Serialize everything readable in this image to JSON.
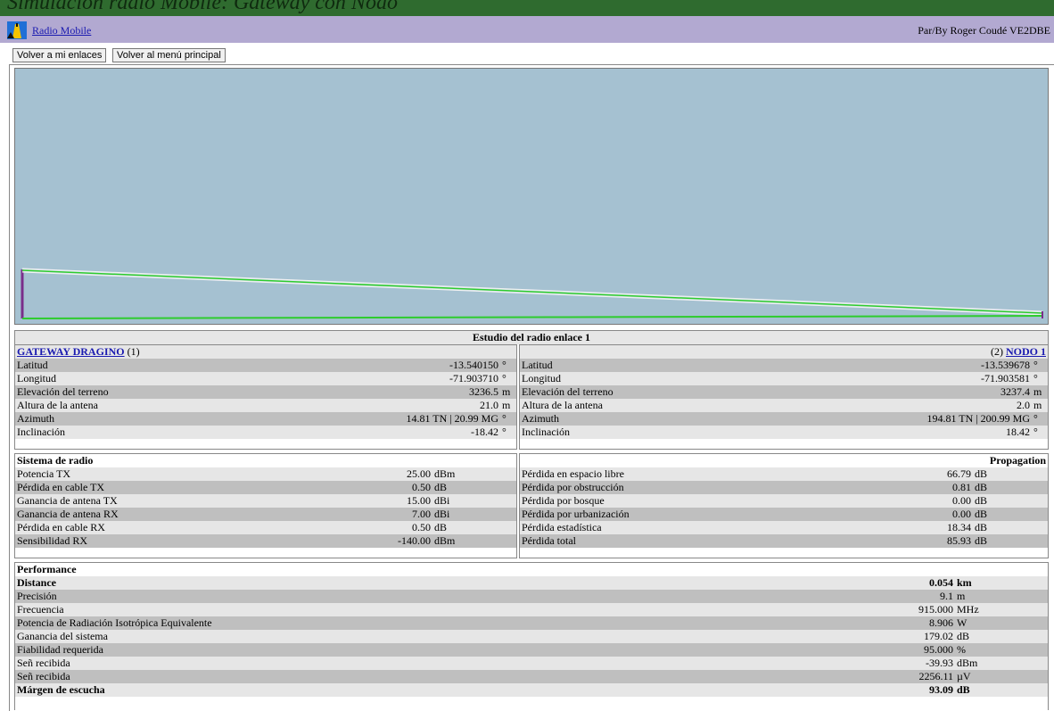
{
  "page": {
    "banner_title": "Simulación radio Mobile: Gateway con Nodo"
  },
  "header": {
    "app_link": "Radio Mobile",
    "author": "Par/By Roger Coudé VE2DBE"
  },
  "nav": {
    "back_links": "Volver a mi enlaces",
    "back_menu": "Volver al menú principal"
  },
  "study": {
    "title": "Estudio del radio enlace 1",
    "left": {
      "name": "GATEWAY DRAGINO",
      "index": "(1)",
      "rows": [
        {
          "label": "Latitud",
          "value": "-13.540150",
          "unit": "°"
        },
        {
          "label": "Longitud",
          "value": "-71.903710",
          "unit": "°"
        },
        {
          "label": "Elevación del terreno",
          "value": "3236.5",
          "unit": "m"
        },
        {
          "label": "Altura de la antena",
          "value": "21.0",
          "unit": "m"
        },
        {
          "label": "Azimuth",
          "value": "14.81 TN | 20.99 MG",
          "unit": "°"
        },
        {
          "label": "Inclinación",
          "value": "-18.42",
          "unit": "°"
        }
      ]
    },
    "right": {
      "name": "NODO 1",
      "index": "(2)",
      "rows": [
        {
          "label": "Latitud",
          "value": "-13.539678",
          "unit": "°"
        },
        {
          "label": "Longitud",
          "value": "-71.903581",
          "unit": "°"
        },
        {
          "label": "Elevación del terreno",
          "value": "3237.4",
          "unit": "m"
        },
        {
          "label": "Altura de la antena",
          "value": "2.0",
          "unit": "m"
        },
        {
          "label": "Azimuth",
          "value": "194.81 TN | 200.99 MG",
          "unit": "°"
        },
        {
          "label": "Inclinación",
          "value": "18.42",
          "unit": "°"
        }
      ]
    }
  },
  "radio": {
    "title": "Sistema de radio",
    "rows": [
      {
        "label": "Potencia TX",
        "value": "25.00",
        "unit": "dBm"
      },
      {
        "label": "Pérdida en cable TX",
        "value": "0.50",
        "unit": "dB"
      },
      {
        "label": "Ganancia de antena TX",
        "value": "15.00",
        "unit": "dBi"
      },
      {
        "label": "Ganancia de antena RX",
        "value": "7.00",
        "unit": "dBi"
      },
      {
        "label": "Pérdida en cable RX",
        "value": "0.50",
        "unit": "dB"
      },
      {
        "label": "Sensibilidad RX",
        "value": "-140.00",
        "unit": "dBm"
      }
    ]
  },
  "propagation": {
    "title": "Propagation",
    "rows": [
      {
        "label": "Pérdida en espacio libre",
        "value": "66.79",
        "unit": "dB"
      },
      {
        "label": "Pérdida por obstrucción",
        "value": "0.81",
        "unit": "dB"
      },
      {
        "label": "Pérdida por bosque",
        "value": "0.00",
        "unit": "dB"
      },
      {
        "label": "Pérdida por urbanización",
        "value": "0.00",
        "unit": "dB"
      },
      {
        "label": "Pérdida estadística",
        "value": "18.34",
        "unit": "dB"
      },
      {
        "label": "Pérdida total",
        "value": "85.93",
        "unit": "dB"
      }
    ]
  },
  "performance": {
    "title": "Performance",
    "rows": [
      {
        "label": "Distance",
        "value": "0.054",
        "unit": "km",
        "bold": true
      },
      {
        "label": "Precisión",
        "value": "9.1",
        "unit": "m"
      },
      {
        "label": "Frecuencia",
        "value": "915.000",
        "unit": "MHz"
      },
      {
        "label": "Potencia de Radiación Isotrópica Equivalente",
        "value": "8.906",
        "unit": "W"
      },
      {
        "label": "Ganancia del sistema",
        "value": "179.02",
        "unit": "dB"
      },
      {
        "label": "Fiabilidad requerida",
        "value": "95.000",
        "unit": "%"
      },
      {
        "label": "Señ recibida",
        "value": "-39.93",
        "unit": "dBm"
      },
      {
        "label": "Señ recibida",
        "value": "2256.11",
        "unit": "µV"
      },
      {
        "label": "Márgen de escucha",
        "value": "93.09",
        "unit": "dB",
        "bold": true
      }
    ]
  },
  "colors": {
    "header_bg": "#b2a9d1",
    "profile_bg": "#a5c1d1",
    "link": "#1a1ab0",
    "terrain": "#2ecc2e"
  }
}
